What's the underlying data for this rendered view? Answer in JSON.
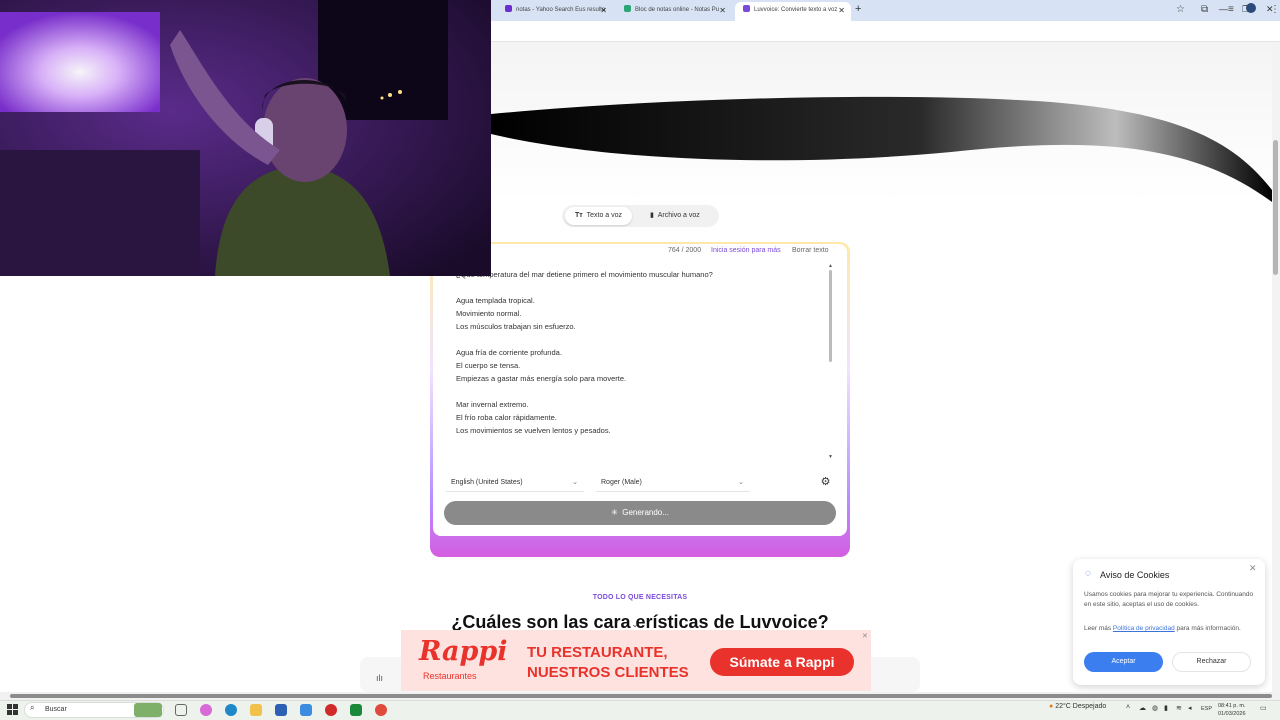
{
  "browser": {
    "tabs": [
      {
        "title": "notas - Yahoo Search Eus resulta",
        "favicon_color": "#6b2fd1"
      },
      {
        "title": "Bloc de notas online - Notas Pu",
        "favicon_color": "#2aa676"
      },
      {
        "title": "Luvvoice: Convierte texto a voz",
        "favicon_color": "#7b4bd8"
      }
    ]
  },
  "app": {
    "modes": [
      "Texto a voz",
      "Archivo a voz"
    ],
    "char_count": "764 / 2000",
    "login_link": "Inicia sesión para más",
    "clear_text": "Borrar texto",
    "text_lines": [
      "¿Qué temperatura del mar detiene primero el movimiento muscular humano?",
      "",
      "Agua templada tropical.",
      "Movimiento normal.",
      "Los músculos trabajan sin esfuerzo.",
      "",
      "Agua fría de corriente profunda.",
      "El cuerpo se tensa.",
      "Empiezas a gastar más energía solo para moverte.",
      "",
      "Mar invernal extremo.",
      "El frío roba calor rápidamente.",
      "Los movimientos se vuelven lentos y pesados."
    ],
    "language": "English (United States)",
    "voice": "Roger (Male)",
    "generate_label": "Generando..."
  },
  "section": {
    "eyebrow": "TODO LO QUE NECESITAS",
    "headline": "¿Cuáles son las cara    erísticas de Luvvoice?"
  },
  "ad": {
    "brand": "Rappi",
    "brand_sub": "Restaurantes",
    "line1": "TU RESTAURANTE,",
    "line2": "NUESTROS CLIENTES",
    "cta": "Súmate a Rappi",
    "brand_color": "#e8322b"
  },
  "cookies": {
    "title": "Aviso de Cookies",
    "body": "Usamos cookies para mejorar tu experiencia. Continuando en este sitio, aceptas el uso de cookies.",
    "more_prefix": "Leer más ",
    "policy_link": "Política de privacidad",
    "more_suffix": " para más información.",
    "accept": "Aceptar",
    "reject": "Rechazar"
  },
  "taskbar": {
    "search_placeholder": "Buscar",
    "weather": "22°C  Despejado",
    "lang": "ESP",
    "time": "08:41 p. m.",
    "date": "01/03/2026"
  }
}
